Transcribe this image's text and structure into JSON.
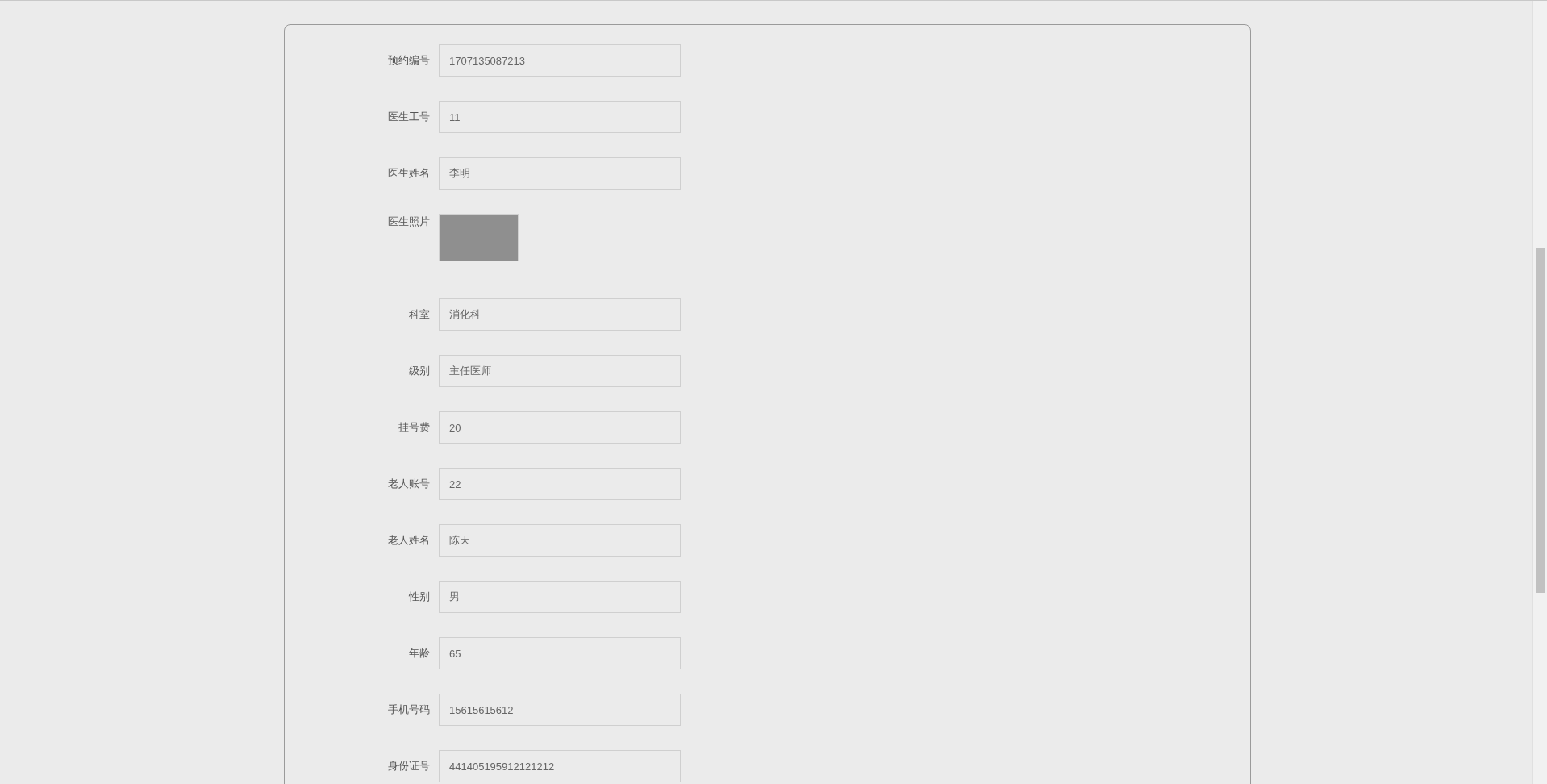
{
  "form": {
    "fields": [
      {
        "kind": "text",
        "label": "预约编号",
        "value": "1707135087213"
      },
      {
        "kind": "text",
        "label": "医生工号",
        "value": "11"
      },
      {
        "kind": "text",
        "label": "医生姓名",
        "value": "李明"
      },
      {
        "kind": "photo",
        "label": "医生照片"
      },
      {
        "kind": "text",
        "label": "科室",
        "value": "消化科"
      },
      {
        "kind": "text",
        "label": "级别",
        "value": "主任医师"
      },
      {
        "kind": "text",
        "label": "挂号费",
        "value": "20"
      },
      {
        "kind": "text",
        "label": "老人账号",
        "value": "22"
      },
      {
        "kind": "text",
        "label": "老人姓名",
        "value": "陈天"
      },
      {
        "kind": "text",
        "label": "性别",
        "value": "男"
      },
      {
        "kind": "text",
        "label": "年龄",
        "value": "65"
      },
      {
        "kind": "text",
        "label": "手机号码",
        "value": "15615615612"
      },
      {
        "kind": "text",
        "label": "身份证号",
        "value": "441405195912121212"
      }
    ]
  }
}
